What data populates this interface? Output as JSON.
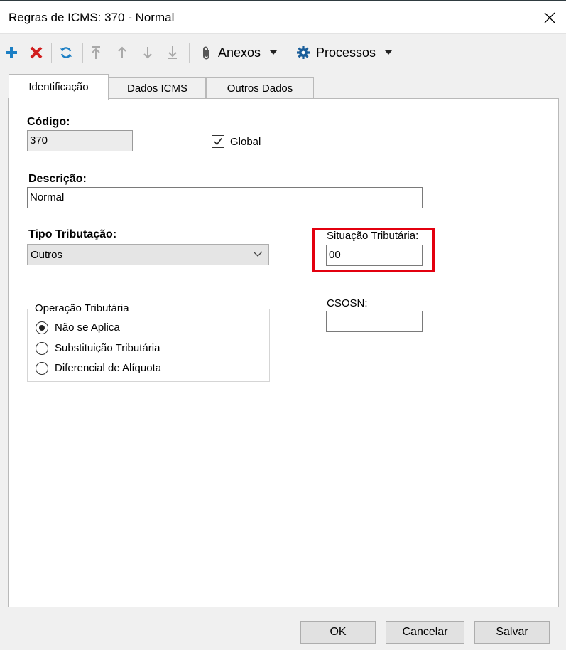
{
  "window": {
    "title": "Regras de ICMS: 370 - Normal",
    "close_icon": "close-icon"
  },
  "toolbar": {
    "add_icon": "plus-icon",
    "delete_icon": "x-icon",
    "refresh_icon": "refresh-icon",
    "move_first_icon": "arrow-top-icon",
    "move_up_icon": "arrow-up-icon",
    "move_down_icon": "arrow-down-icon",
    "move_last_icon": "arrow-bottom-icon",
    "anexos_label": "Anexos",
    "processos_label": "Processos",
    "accent_blue": "#1c7fc4",
    "accent_red": "#d11f1f"
  },
  "tabs": [
    {
      "label": "Identificação",
      "active": true
    },
    {
      "label": "Dados ICMS",
      "active": false
    },
    {
      "label": "Outros Dados",
      "active": false
    }
  ],
  "form": {
    "codigo_label": "Código:",
    "codigo_value": "370",
    "global_label": "Global",
    "global_checked": true,
    "descricao_label": "Descrição:",
    "descricao_value": "Normal",
    "tipo_tributacao_label": "Tipo Tributação:",
    "tipo_tributacao_value": "Outros",
    "situacao_tributaria_label": "Situação Tributária:",
    "situacao_tributaria_value": "00",
    "csosn_label": "CSOSN:",
    "csosn_value": "",
    "operacao_group_label": "Operação Tributária",
    "operacao_options": [
      {
        "label": "Não se Aplica",
        "checked": true
      },
      {
        "label": "Substituição Tributária",
        "checked": false
      },
      {
        "label": "Diferencial de Alíquota",
        "checked": false
      }
    ]
  },
  "buttons": {
    "ok": "OK",
    "cancelar": "Cancelar",
    "salvar": "Salvar"
  },
  "highlight_color": "#e3000f"
}
